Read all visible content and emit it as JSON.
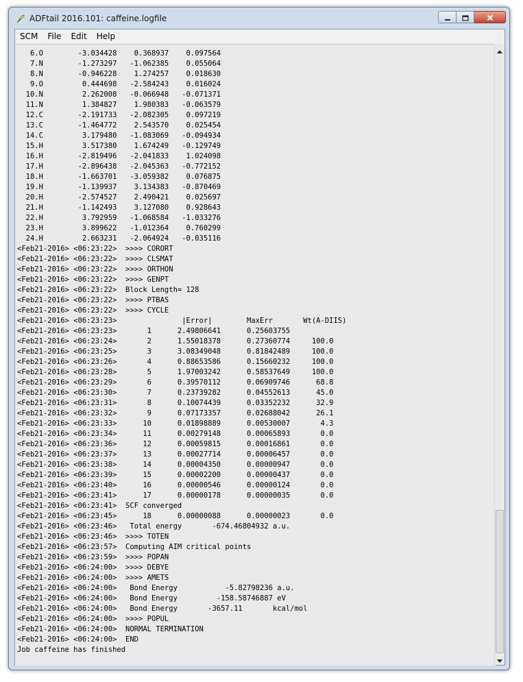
{
  "window": {
    "title": "ADFtail 2016.101: caffeine.logfile"
  },
  "menu": {
    "items": [
      "SCM",
      "File",
      "Edit",
      "Help"
    ]
  },
  "log": {
    "lines": [
      "   6.O        -3.034428    0.368937    0.097564",
      "   7.N        -1.273297   -1.062385    0.055064",
      "   8.N        -0.946228    1.274257    0.018630",
      "   9.O         0.444698   -2.584243    0.016024",
      "  10.N         2.262008   -0.066948   -0.071371",
      "  11.N         1.384827    1.980383   -0.063579",
      "  12.C        -2.191733   -2.082305    0.097219",
      "  13.C        -1.464772    2.543570    0.025454",
      "  14.C         3.179480   -1.083069   -0.094934",
      "  15.H         3.517380    1.674249   -0.129749",
      "  16.H        -2.819496   -2.041833    1.024098",
      "  17.H        -2.896438   -2.045363   -0.772152",
      "  18.H        -1.663701   -3.059382    0.076875",
      "  19.H        -1.139937    3.134383   -0.870469",
      "  20.H        -2.574527    2.490421    0.025697",
      "  21.H        -1.142493    3.127080    0.928643",
      "  22.H         3.792959   -1.068584   -1.033276",
      "  23.H         3.899622   -1.012364    0.760299",
      "  24.H         2.663231   -2.064924   -0.035116",
      "<Feb21-2016> <06:23:22>  >>>> CORORT",
      "<Feb21-2016> <06:23:22>  >>>> CLSMAT",
      "<Feb21-2016> <06:23:22>  >>>> ORTHON",
      "<Feb21-2016> <06:23:22>  >>>> GENPT",
      "<Feb21-2016> <06:23:22>  Block Length= 128",
      "<Feb21-2016> <06:23:22>  >>>> PTBAS",
      "<Feb21-2016> <06:23:22>  >>>> CYCLE",
      "<Feb21-2016> <06:23:23>               |Error|        MaxErr       Wt(A-DIIS)",
      "<Feb21-2016> <06:23:23>       1      2.49806641      0.25603755",
      "<Feb21-2016> <06:23:24>       2      1.55018378      0.27360774     100.0",
      "<Feb21-2016> <06:23:25>       3      3.08349048      0.81842489     100.0",
      "<Feb21-2016> <06:23:26>       4      0.88653586      0.15660232     100.0",
      "<Feb21-2016> <06:23:28>       5      1.97003242      0.58537649     100.0",
      "<Feb21-2016> <06:23:29>       6      0.39570112      0.06909746      68.8",
      "<Feb21-2016> <06:23:30>       7      0.23739282      0.04552613      45.0",
      "<Feb21-2016> <06:23:31>       8      0.10074439      0.03352232      32.9",
      "<Feb21-2016> <06:23:32>       9      0.07173357      0.02688042      26.1",
      "<Feb21-2016> <06:23:33>      10      0.01898889      0.00530007       4.3",
      "<Feb21-2016> <06:23:34>      11      0.00279148      0.00065893       0.0",
      "<Feb21-2016> <06:23:36>      12      0.00059815      0.00016861       0.0",
      "<Feb21-2016> <06:23:37>      13      0.00027714      0.00006457       0.0",
      "<Feb21-2016> <06:23:38>      14      0.00004350      0.00000947       0.0",
      "<Feb21-2016> <06:23:39>      15      0.00002200      0.00000437       0.0",
      "<Feb21-2016> <06:23:40>      16      0.00000546      0.00000124       0.0",
      "<Feb21-2016> <06:23:41>      17      0.00000178      0.00000035       0.0",
      "<Feb21-2016> <06:23:41>  SCF converged",
      "<Feb21-2016> <06:23:45>      18      0.00000088      0.00000023       0.0",
      "<Feb21-2016> <06:23:46>   Total energy       -674.46804932 a.u.",
      "<Feb21-2016> <06:23:46>  >>>> TOTEN",
      "<Feb21-2016> <06:23:57>  Computing AIM critical points",
      "<Feb21-2016> <06:23:59>  >>>> POPAN",
      "<Feb21-2016> <06:24:00>  >>>> DEBYE",
      "<Feb21-2016> <06:24:00>  >>>> AMETS",
      "<Feb21-2016> <06:24:00>   Bond Energy           -5.82798236 a.u.",
      "<Feb21-2016> <06:24:00>   Bond Energy         -158.58746887 eV",
      "<Feb21-2016> <06:24:00>   Bond Energy       -3657.11       kcal/mol",
      "<Feb21-2016> <06:24:00>  >>>> POPUL",
      "<Feb21-2016> <06:24:00>  NORMAL TERMINATION",
      "<Feb21-2016> <06:24:00>  END",
      "Job caffeine has finished"
    ]
  },
  "scrollbar": {
    "position_fraction": 1.0,
    "visible_fraction": 0.24
  },
  "icons": {
    "app": "feather-pen-icon",
    "minimize": "minimize-icon",
    "maximize": "maximize-icon",
    "close": "close-icon",
    "scroll_up": "arrow-up-icon",
    "scroll_down": "arrow-down-icon"
  },
  "colors": {
    "close_button": "#c8452c",
    "text_background": "#e9e9e9"
  }
}
